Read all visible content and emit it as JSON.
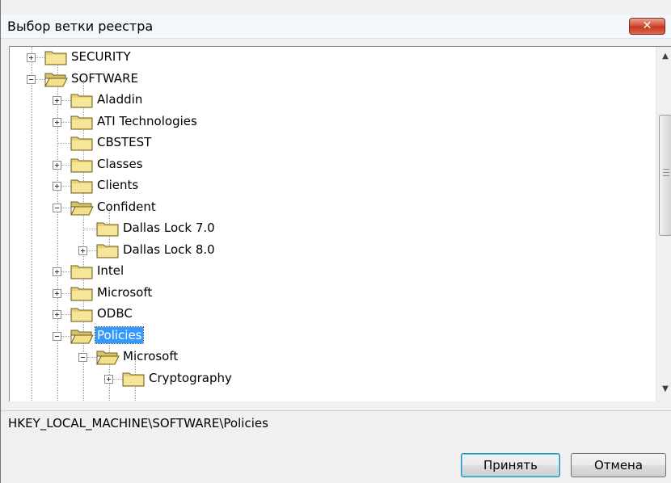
{
  "window": {
    "title": "Выбор ветки реестра",
    "close_icon": "close-x-icon",
    "close_label": "✕"
  },
  "tree": {
    "nodes": [
      {
        "label": "SECURITY",
        "expander": "plus",
        "folder": "closed"
      },
      {
        "label": "SOFTWARE",
        "expander": "minus",
        "folder": "open"
      },
      {
        "label": "Aladdin",
        "expander": "plus",
        "folder": "closed"
      },
      {
        "label": "ATI Technologies",
        "expander": "plus",
        "folder": "closed"
      },
      {
        "label": "CBSTEST",
        "expander": "none",
        "folder": "closed"
      },
      {
        "label": "Classes",
        "expander": "plus",
        "folder": "closed"
      },
      {
        "label": "Clients",
        "expander": "plus",
        "folder": "closed"
      },
      {
        "label": "Confident",
        "expander": "minus",
        "folder": "open"
      },
      {
        "label": "Dallas Lock 7.0",
        "expander": "none",
        "folder": "closed"
      },
      {
        "label": "Dallas Lock 8.0",
        "expander": "plus",
        "folder": "closed"
      },
      {
        "label": "Intel",
        "expander": "plus",
        "folder": "closed"
      },
      {
        "label": "Microsoft",
        "expander": "plus",
        "folder": "closed"
      },
      {
        "label": "ODBC",
        "expander": "plus",
        "folder": "closed"
      },
      {
        "label": "Policies",
        "expander": "minus",
        "folder": "open",
        "selected": true
      },
      {
        "label": "Microsoft",
        "expander": "minus",
        "folder": "open"
      },
      {
        "label": "Cryptography",
        "expander": "plus",
        "folder": "closed"
      }
    ],
    "scroll_up_icon": "scroll-up-arrow-icon",
    "scroll_down_icon": "scroll-down-arrow-icon"
  },
  "path": {
    "value": "HKEY_LOCAL_MACHINE\\SOFTWARE\\Policies"
  },
  "buttons": {
    "accept": "Принять",
    "cancel": "Отмена"
  }
}
